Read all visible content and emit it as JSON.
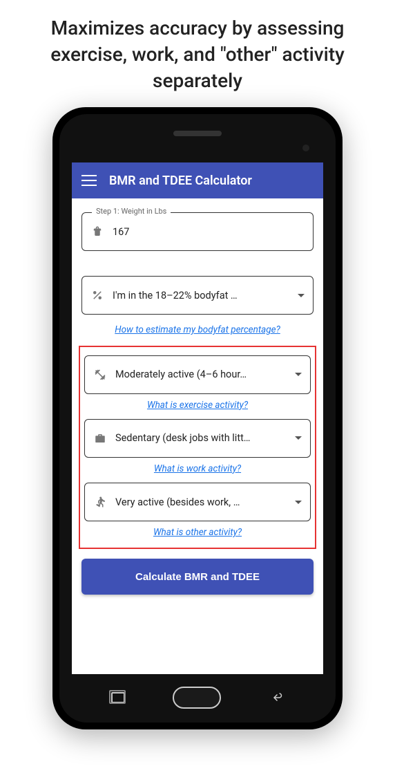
{
  "headline": "Maximizes accuracy by assessing exercise, work, and \"other\" activity separately",
  "appbar": {
    "title": "BMR and TDEE Calculator"
  },
  "weight": {
    "label": "Step 1: Weight in Lbs",
    "value": "167",
    "icon": "weight-icon"
  },
  "bodyfat": {
    "value": "I'm in the 18–22% bodyfat …",
    "icon": "percent-icon",
    "help": "How to estimate my bodyfat percentage?"
  },
  "exercise": {
    "value": "Moderately active (4–6 hour…",
    "icon": "dumbbell-icon",
    "help": "What is exercise activity?"
  },
  "work": {
    "value": "Sedentary (desk jobs with litt…",
    "icon": "briefcase-icon",
    "help": "What is work activity?"
  },
  "other": {
    "value": "Very active (besides work, …",
    "icon": "walker-icon",
    "help": "What is other activity?"
  },
  "cta": {
    "label": "Calculate BMR and TDEE"
  },
  "colors": {
    "primary": "#3f51b5",
    "link": "#1a73e8",
    "highlight": "#e63232"
  }
}
